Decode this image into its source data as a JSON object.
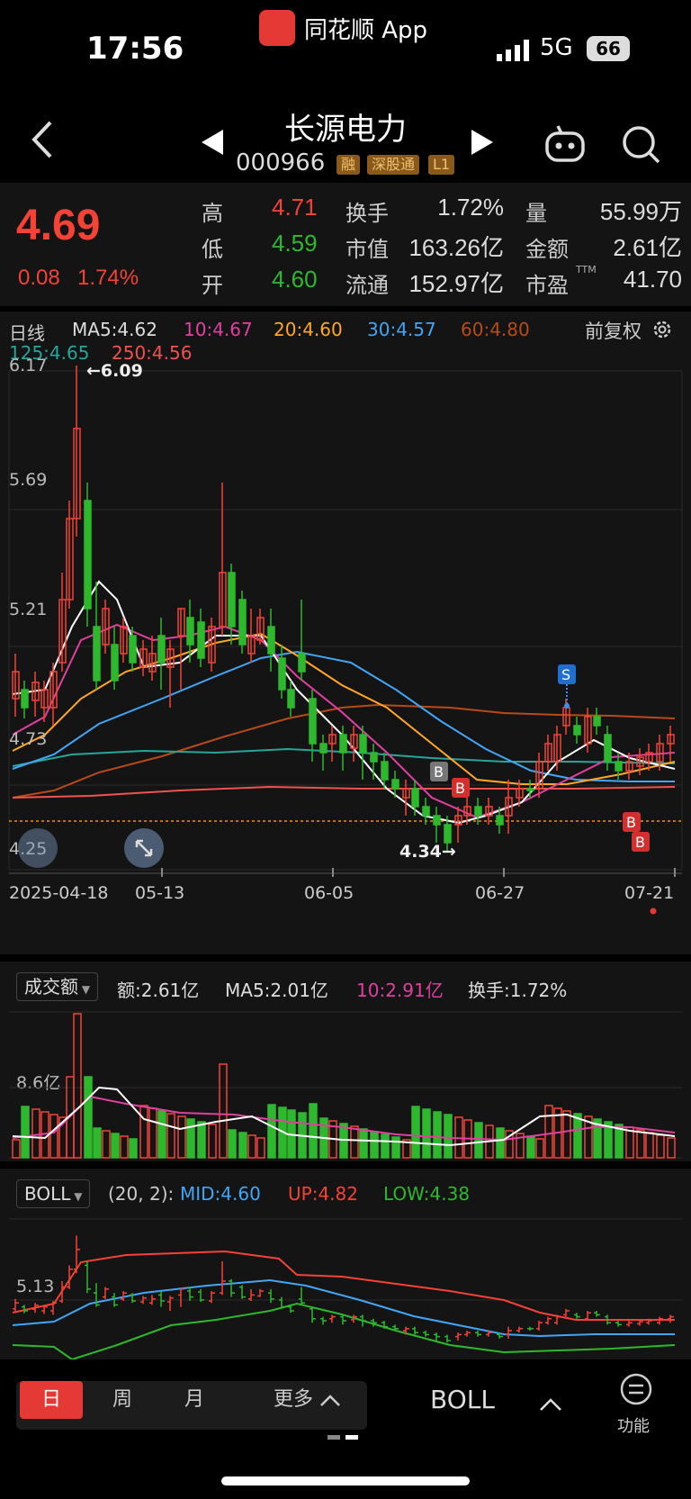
{
  "status_bar": {
    "time": "17:56",
    "app_name": "同花顺 App",
    "network": "5G",
    "battery": "66"
  },
  "stock": {
    "name": "长源电力",
    "code": "000966",
    "tags": [
      "融",
      "深股通",
      "L1"
    ],
    "price": "4.69",
    "change": "0.08",
    "change_pct": "1.74%",
    "high": "4.71",
    "low": "4.59",
    "open": "4.60",
    "turnover": "1.72%",
    "market_cap": "163.26亿",
    "float_cap": "152.97亿",
    "volume": "55.99万",
    "amount": "2.61亿",
    "pe": "41.70",
    "labels": {
      "high": "高",
      "low": "低",
      "open": "开",
      "turnover": "换手",
      "market_cap": "市值",
      "float_cap": "流通",
      "volume": "量",
      "amount": "金额",
      "pe": "市盈",
      "pe_sup": "TTM"
    }
  },
  "kline": {
    "period": "日线",
    "ma": [
      {
        "label": "MA5:4.62",
        "color": "#dddddd"
      },
      {
        "label": "10:4.67",
        "color": "#e040a0"
      },
      {
        "label": "20:4.60",
        "color": "#ffa726"
      },
      {
        "label": "30:4.57",
        "color": "#42a5f5"
      },
      {
        "label": "60:4.80",
        "color": "#b84a18"
      },
      {
        "label": "125:4.65",
        "color": "#26a69a"
      },
      {
        "label": "250:4.56",
        "color": "#ef5350"
      }
    ],
    "adjust": "前复权",
    "y_ticks": [
      "6.17",
      "5.69",
      "5.21",
      "4.73",
      "4.25"
    ],
    "max_label": "←6.09",
    "min_label": "4.34→",
    "x_ticks": [
      "2025-04-18",
      "05-13",
      "06-05",
      "06-27",
      "07-21"
    ],
    "markers": {
      "s": "S",
      "b": "B"
    }
  },
  "volume_panel": {
    "selector": "成交额",
    "amount": "额:2.61亿",
    "ma5": "MA5:2.01亿",
    "ma10": "10:2.91亿",
    "turnover": "换手:1.72%",
    "y_tick": "8.6亿"
  },
  "boll_panel": {
    "selector": "BOLL",
    "params": "(20, 2):",
    "mid": "MID:4.60",
    "up": "UP:4.82",
    "low": "LOW:4.38",
    "y_tick": "5.13"
  },
  "bottom_bar": {
    "periods": [
      "日",
      "周",
      "月"
    ],
    "more": "更多",
    "indicator": "BOLL",
    "function": "功能"
  },
  "colors": {
    "up": "#f44336",
    "down": "#2eb82e",
    "bg": "#141414"
  }
}
